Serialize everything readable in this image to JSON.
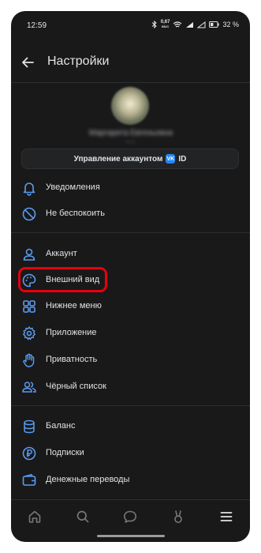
{
  "status_bar": {
    "time": "12:59",
    "net_speed_value": "0,67",
    "net_speed_unit": "КБ/С",
    "battery_label": "32 %"
  },
  "header": {
    "title": "Настройки"
  },
  "profile": {
    "name": "Маргарита Евгеньевна",
    "subtitle": "• • •"
  },
  "account_button": {
    "label": "Управление аккаунтом",
    "vk_badge": "VK",
    "id_label": "ID"
  },
  "menu": {
    "items": [
      {
        "label": "Уведомления",
        "icon": "bell-icon"
      },
      {
        "label": "Не беспокоить",
        "icon": "do-not-disturb-icon"
      },
      {
        "label": "Аккаунт",
        "icon": "user-icon"
      },
      {
        "label": "Внешний вид",
        "icon": "palette-icon"
      },
      {
        "label": "Нижнее меню",
        "icon": "grid-icon"
      },
      {
        "label": "Приложение",
        "icon": "gear-icon"
      },
      {
        "label": "Приватность",
        "icon": "hand-icon"
      },
      {
        "label": "Чёрный список",
        "icon": "users-icon"
      },
      {
        "label": "Баланс",
        "icon": "coins-icon"
      },
      {
        "label": "Подписки",
        "icon": "ruble-icon"
      },
      {
        "label": "Денежные переводы",
        "icon": "wallet-icon"
      }
    ]
  },
  "tabbar": {
    "tabs": [
      "home-icon",
      "search-icon",
      "messages-icon",
      "clips-icon",
      "menu-icon"
    ]
  },
  "colors": {
    "background": "#19191a",
    "accent": "#5a9cf0",
    "text": "#e1e3e6",
    "highlight": "#e8000d"
  }
}
